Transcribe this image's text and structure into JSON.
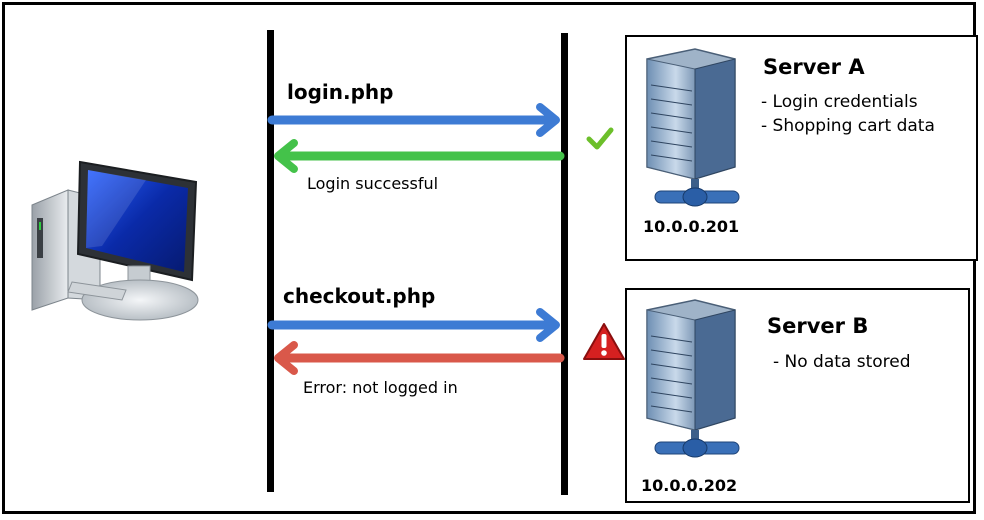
{
  "requests": [
    {
      "endpoint": "login.php",
      "response": "Login successful",
      "response_color": "#44c24a",
      "status_icon": "checkmark-icon"
    },
    {
      "endpoint": "checkout.php",
      "response": "Error: not logged in",
      "response_color": "#d9584a",
      "status_icon": "warning-icon"
    }
  ],
  "request_color": "#3d7bd4",
  "servers": [
    {
      "name": "Server A",
      "ip": "10.0.0.201",
      "bullets": [
        "- Login credentials",
        "- Shopping cart data"
      ]
    },
    {
      "name": "Server B",
      "ip": "10.0.0.202",
      "bullets": [
        "- No data stored"
      ]
    }
  ],
  "client_icon": "desktop-computer-icon",
  "server_icon": "server-tower-icon"
}
